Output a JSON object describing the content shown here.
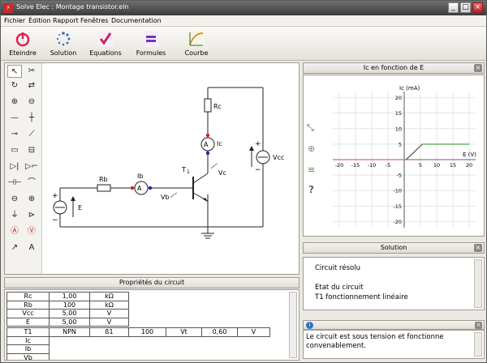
{
  "window": {
    "title": "Solve Elec : Montage transistor.eln"
  },
  "menu": [
    "Fichier",
    "Édition",
    "Rapport",
    "Fenêtres",
    "Documentation"
  ],
  "toolbar": [
    {
      "label": "Eteindre",
      "icon": "power-icon",
      "color": "#d8234f"
    },
    {
      "label": "Solution",
      "icon": "spinner-icon",
      "color": "#2f6fc8"
    },
    {
      "label": "Equations",
      "icon": "checkmark-icon",
      "color": "#d0206c"
    },
    {
      "label": "Formules",
      "icon": "equals-icon",
      "color": "#7a2fb8"
    },
    {
      "label": "Courbe",
      "icon": "curve-icon",
      "color": "#c8a030"
    }
  ],
  "circuit": {
    "rc": "Rc",
    "ic": "Ic",
    "vc": "Vc",
    "vcc": "Vcc",
    "t1": "T",
    "t1_sub": "1",
    "rb": "Rb",
    "ib": "Ib",
    "vb": "Vb",
    "e": "E",
    "ammeter": "A",
    "plus": "+",
    "minus": "−"
  },
  "properties": {
    "title": "Propriétés du circuit",
    "rows": [
      [
        "Rc",
        "1,00",
        "kΩ"
      ],
      [
        "Rb",
        "100",
        "kΩ"
      ],
      [
        "Vcc",
        "5,00",
        "V"
      ],
      [
        "E",
        "5,00",
        "V"
      ],
      [
        "T1",
        "NPN",
        "ß1",
        "100",
        "Vt",
        "0,60",
        "V"
      ],
      [
        "Ic"
      ],
      [
        "Ib"
      ],
      [
        "Vb"
      ]
    ]
  },
  "graph": {
    "title": "Ic en fonction de E",
    "ylabel": "Ic (mA)",
    "xlabel": "E (V)",
    "xticks": [
      "-20",
      "-15",
      "-10",
      "-5",
      "5",
      "10",
      "15",
      "20"
    ],
    "yticks": [
      "20",
      "15",
      "10",
      "5",
      "-5",
      "-10",
      "-15",
      "-20"
    ],
    "help": "?"
  },
  "chart_data": {
    "type": "line",
    "title": "Ic en fonction de E",
    "xlabel": "E (V)",
    "ylabel": "Ic (mA)",
    "xlim": [
      -22,
      22
    ],
    "ylim": [
      -22,
      22
    ],
    "grid": true,
    "series": [
      {
        "color": "#d04040",
        "x": [
          -22,
          0.6
        ],
        "y": [
          0,
          0
        ]
      },
      {
        "color": "#404040",
        "x": [
          0.6,
          5.6
        ],
        "y": [
          0,
          5
        ]
      },
      {
        "color": "#3a9a3a",
        "x": [
          5.6,
          20
        ],
        "y": [
          5,
          5
        ]
      }
    ]
  },
  "solution": {
    "title": "Solution",
    "lines": [
      "Circuit résolu",
      "",
      "Etat du circuit",
      "T1 fonctionnement linéaire"
    ]
  },
  "message": {
    "text": "Le circuit est sous tension et fonctionne convenablement."
  }
}
